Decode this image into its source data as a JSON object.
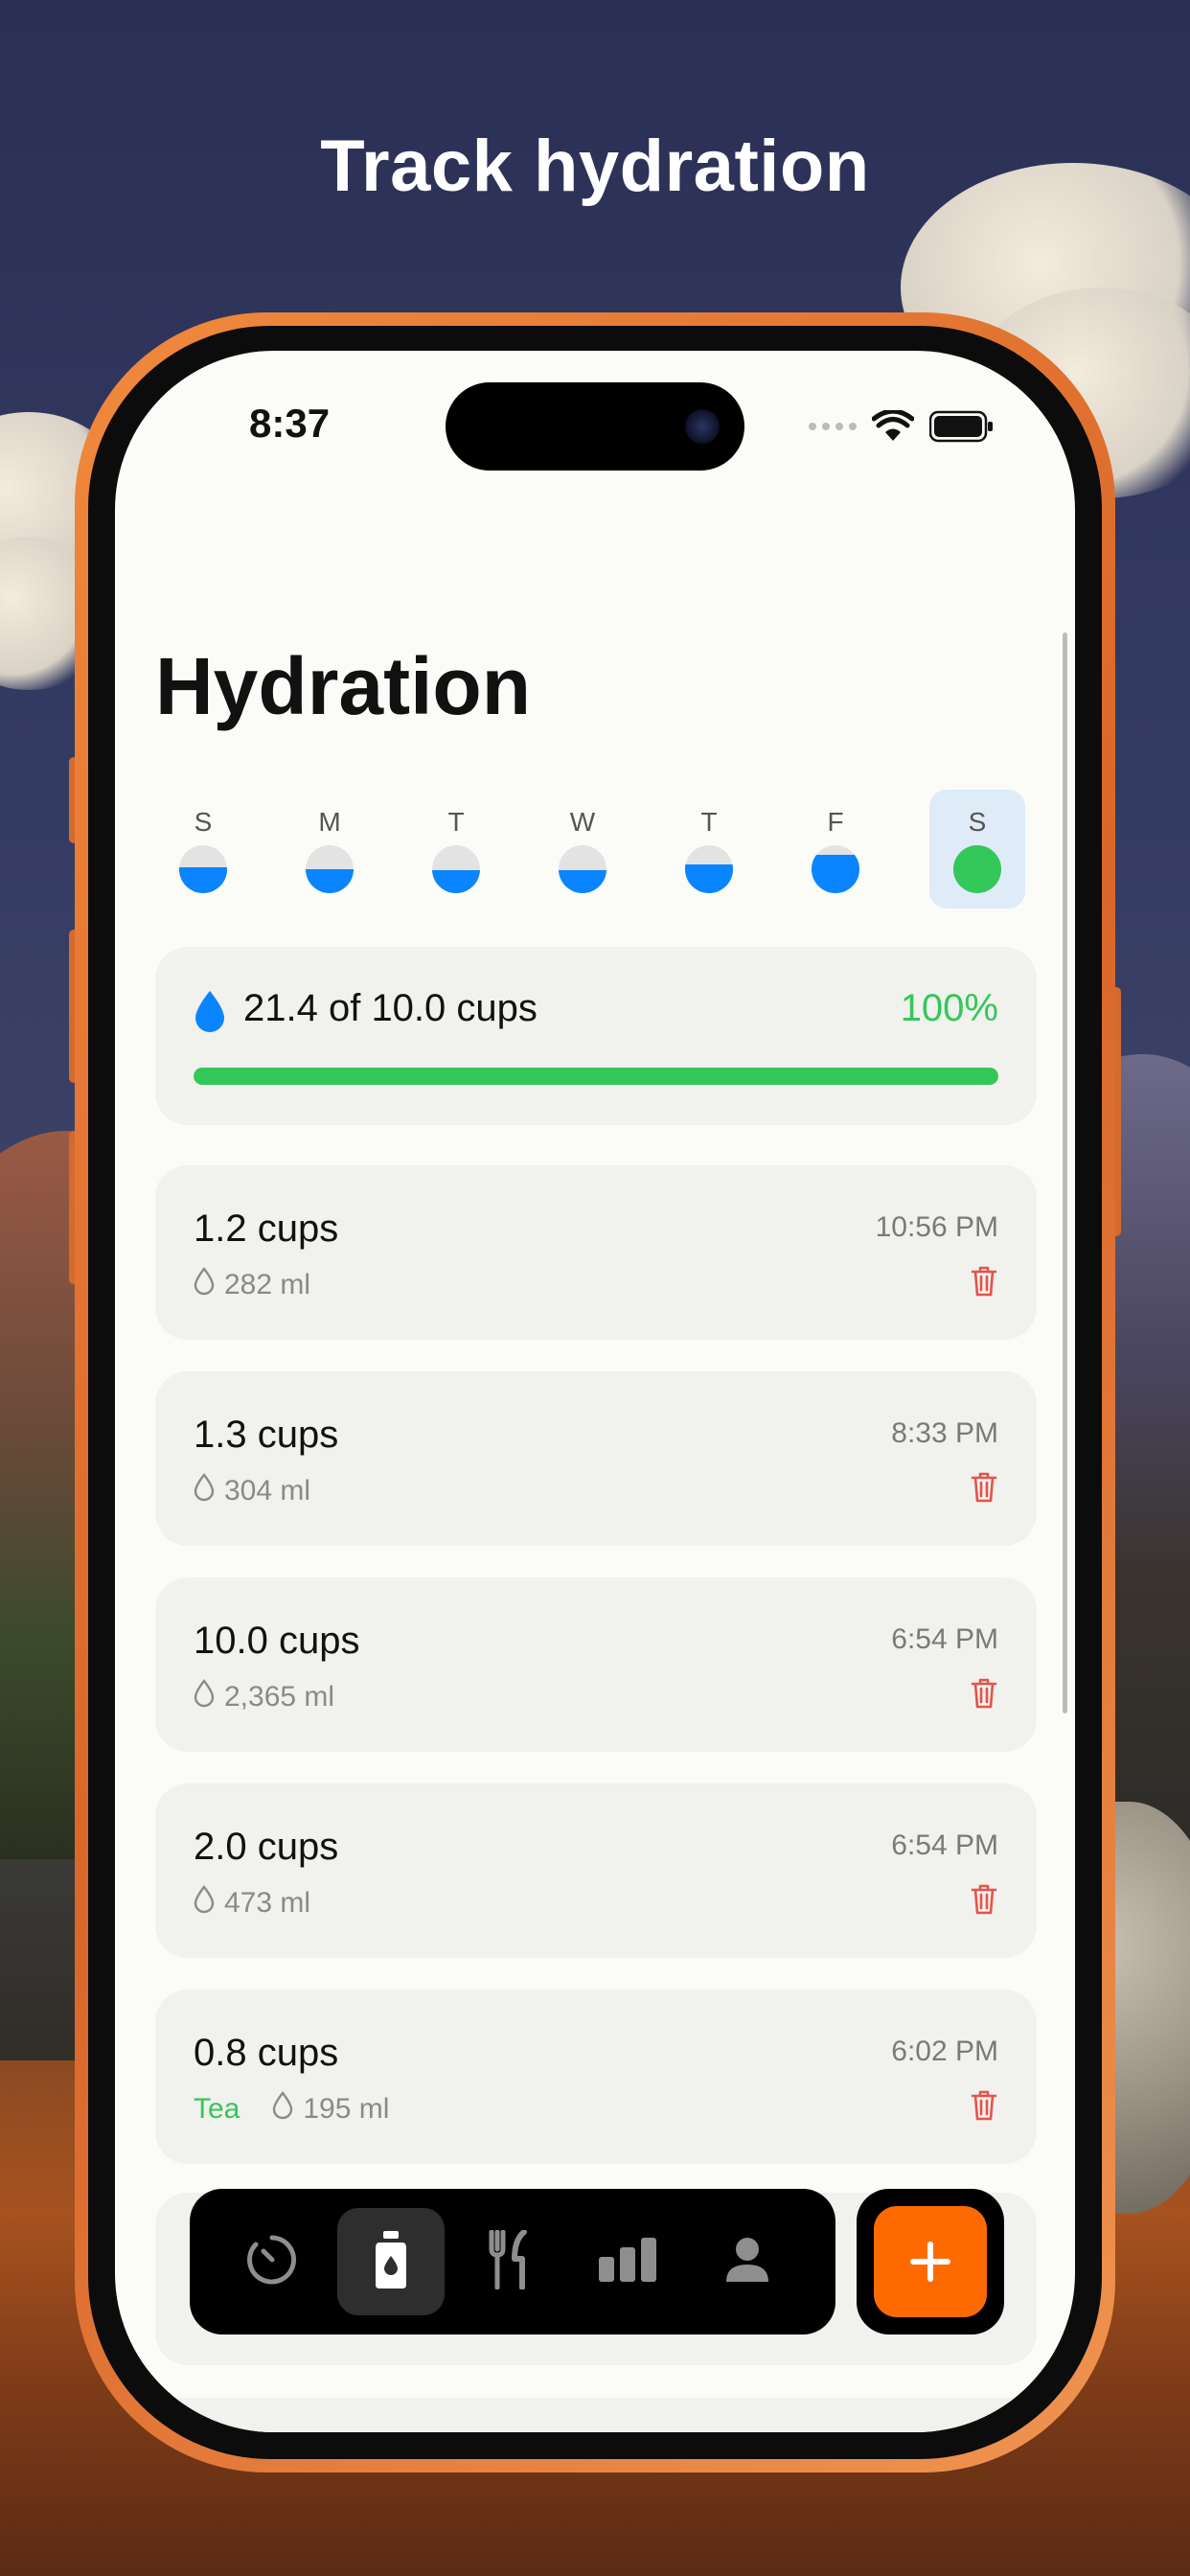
{
  "headline": "Track hydration",
  "status": {
    "time": "8:37"
  },
  "page": {
    "title": "Hydration"
  },
  "week": [
    {
      "letter": "S",
      "fill_fraction": 0.55,
      "selected": false
    },
    {
      "letter": "M",
      "fill_fraction": 0.5,
      "selected": false
    },
    {
      "letter": "T",
      "fill_fraction": 0.48,
      "selected": false
    },
    {
      "letter": "W",
      "fill_fraction": 0.48,
      "selected": false
    },
    {
      "letter": "T",
      "fill_fraction": 0.6,
      "selected": false
    },
    {
      "letter": "F",
      "fill_fraction": 0.8,
      "selected": false
    },
    {
      "letter": "S",
      "fill_fraction": 1.0,
      "selected": true
    }
  ],
  "summary": {
    "text": "21.4 of 10.0 cups",
    "percent": "100%",
    "progress_fraction": 1.0
  },
  "entries": [
    {
      "amount": "1.2 cups",
      "ml": "282 ml",
      "time": "10:56 PM",
      "tag": ""
    },
    {
      "amount": "1.3 cups",
      "ml": "304 ml",
      "time": "8:33 PM",
      "tag": ""
    },
    {
      "amount": "10.0 cups",
      "ml": "2,365 ml",
      "time": "6:54 PM",
      "tag": ""
    },
    {
      "amount": "2.0 cups",
      "ml": "473 ml",
      "time": "6:54 PM",
      "tag": ""
    },
    {
      "amount": "0.8 cups",
      "ml": "195 ml",
      "time": "6:02 PM",
      "tag": "Tea"
    }
  ],
  "tabs": [
    {
      "icon": "timer-icon",
      "active": false
    },
    {
      "icon": "bottle-icon",
      "active": true
    },
    {
      "icon": "fork-knife-icon",
      "active": false
    },
    {
      "icon": "bar-chart-icon",
      "active": false
    },
    {
      "icon": "person-icon",
      "active": false
    }
  ],
  "add_button": {
    "icon": "plus-icon"
  },
  "colors": {
    "accent_blue": "#0a84ff",
    "success_green": "#34c759",
    "delete_red": "#e5534b",
    "add_orange": "#ff6a00",
    "phone_frame": "#e8772f"
  }
}
